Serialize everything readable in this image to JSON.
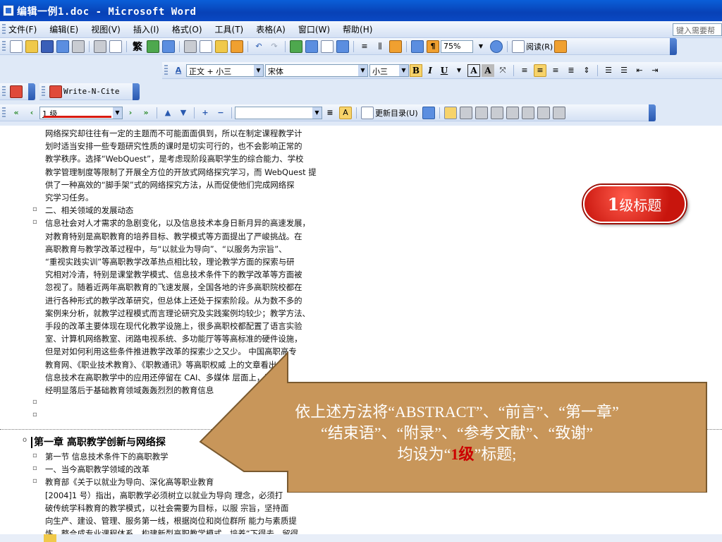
{
  "window": {
    "title": "编辑一例1.doc - Microsoft Word"
  },
  "menu": {
    "items": [
      "文件(F)",
      "编辑(E)",
      "视图(V)",
      "插入(I)",
      "格式(O)",
      "工具(T)",
      "表格(A)",
      "窗口(W)",
      "帮助(H)"
    ],
    "help_placeholder": "键入需要帮"
  },
  "standard_toolbar": {
    "traditional_char": "繁",
    "zoom": "75%",
    "read_mode": "阅读(R)"
  },
  "formatting_toolbar": {
    "style": "正文 + 小三",
    "font": "宋体",
    "size": "小三",
    "bold": "B",
    "italic": "I",
    "underline": "U",
    "char_border": "A",
    "char_shading": "A"
  },
  "writencite_toolbar": {
    "label": "Write-N-Cite"
  },
  "outline_toolbar": {
    "level": "1 级",
    "update_toc": "更新目录(U)"
  },
  "document": {
    "paragraphs": [
      "网络探究却往往有一定的主题而不可能面面俱到，所以在制定课程教学计",
      "划时适当安排一些专题研究性质的课时是切实可行的，也不会影响正常的",
      "教学秩序。选择“WebQuest”，是考虑现阶段高职学生的综合能力、学校",
      "教学管理制度等限制了开展全方位的开放式网络探究学习，而 WebQuest 提",
      "供了一种高效的“脚手架”式的网络探究方法，从而促使他们完成网络探",
      "究学习任务。",
      "二、相关领域的发展动态",
      "信息社会对人才需求的急剧变化，以及信息技术本身日新月异的高速发展，",
      "对教育特别是高职教育的培养目标、教学模式等方面提出了严峻挑战。在",
      "高职教育与教学改革过程中，与“以就业为导向”、“以服务为宗旨”、",
      "“重视实践实训”等高职教学改革热点相比较，理论教学方面的探索与研",
      "究相对冷清，特别是课堂教学模式、信息技术条件下的教学改革等方面被",
      "忽视了。随着近两年高职教育的飞速发展，全国各地的许多高职院校都在",
      "进行各种形式的教学改革研究，但总体上还处于探索阶段。从为数不多的",
      "案例来分析，就教学过程模式而言理论研究及实践案例均较少；教学方法、",
      "手段的改革主要体现在现代化教学设施上，很多高职校都配置了语言实验",
      "室、计算机网络教室、闭路电视系统、多功能厅等等高标准的硬件设施，",
      "但是对如何利用这些条件推进教学改革的探索少之又少。 中国高职高专",
      "教育网、《职业技术教育》、《职教通讯》等高职权威        上的文章看出，",
      "信息技术在高职教学中的应用还停留在 CAI、多媒体        层面上，这已",
      "经明显落后于基础教育领域轰轰烈烈的教育信息"
    ],
    "chapter_heading": "第一章   高职教学创新与网络探",
    "after_lines": [
      "第一节  信息技术条件下的高职教学",
      "一、当今高职教学领域的改革",
      "教育部《关于以就业为导向、深化高等职业教育",
      "[2004]1 号）指出，高职教学必须树立以就业为导向         理念，必须打",
      "破传统学科教育的教学模式，以社会需要为目标，以服         宗旨，坚持面",
      "向生产、建设、管理、服务第一线，根据岗位和岗位群所         能力与素质提",
      "炼，整合成专业课程体系，构建新型高职教学模式，培养“下得去、留得"
    ]
  },
  "badge": {
    "number": "1",
    "text": "级标题"
  },
  "callout": {
    "line1": "依上述方法将“ABSTRACT”、“前言”、“第一章”",
    "line2": "“结束语”、“附录”、“参考文献”、“致谢”",
    "line3_before": "均设为“",
    "line3_highlight": "1级",
    "line3_after": "”标题;"
  },
  "colors": {
    "callout_fill": "#c8965a",
    "badge_fill": "#d81a10",
    "title_bar": "#0a55d0"
  }
}
